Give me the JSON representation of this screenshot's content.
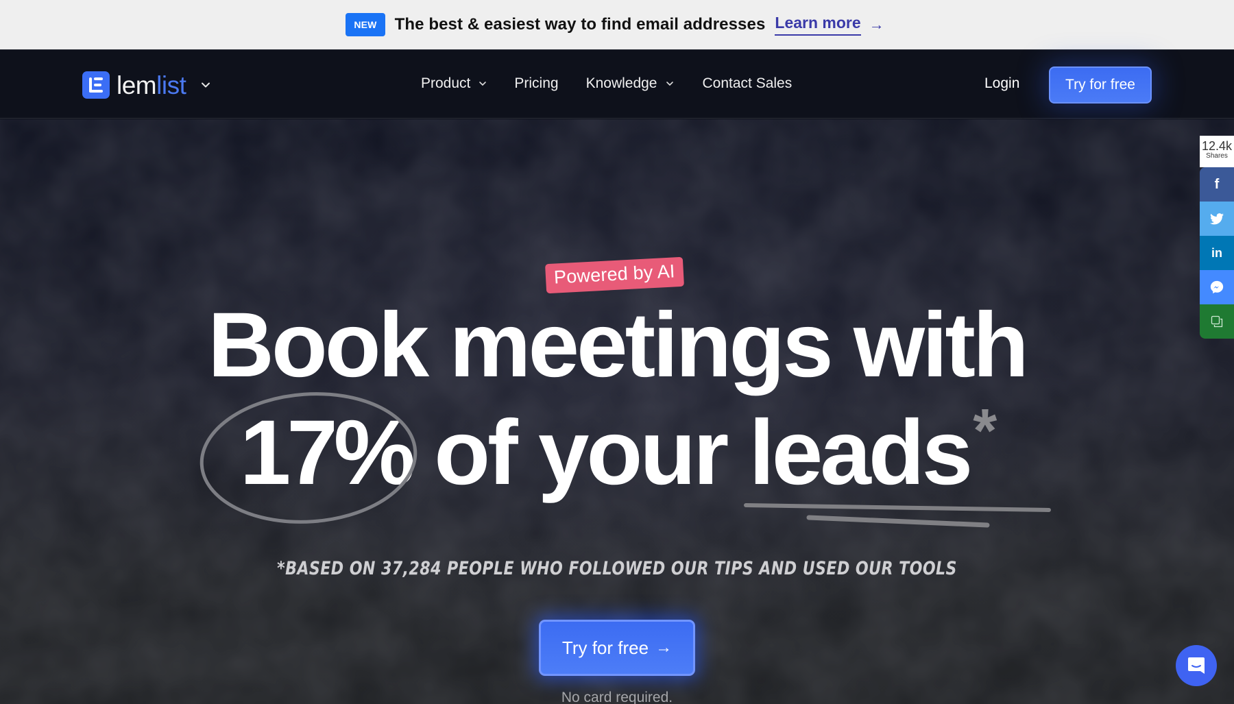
{
  "announcement": {
    "badge": "NEW",
    "text": "The best & easiest way to find email addresses",
    "link_label": "Learn more",
    "arrow": "→"
  },
  "nav": {
    "logo": {
      "part1": "lem",
      "part2": "list"
    },
    "menu": [
      {
        "label": "Product",
        "has_dropdown": true
      },
      {
        "label": "Pricing",
        "has_dropdown": false
      },
      {
        "label": "Knowledge",
        "has_dropdown": true
      },
      {
        "label": "Contact Sales",
        "has_dropdown": false
      }
    ],
    "login_label": "Login",
    "cta_label": "Try for free"
  },
  "hero": {
    "tag": "Powered by AI",
    "headline_line1": "Book meetings with",
    "headline_pct": "17%",
    "headline_rest": "of your leads",
    "headline_star": "*",
    "footnote": "*Based on  37,284  people who followed  our tips and used our tools",
    "cta_label": "Try for free",
    "cta_arrow": "→",
    "subnote": "No card required."
  },
  "share": {
    "count": "12.4k",
    "count_label": "Shares",
    "buttons": [
      {
        "icon": "facebook-icon",
        "glyph": "f"
      },
      {
        "icon": "twitter-icon",
        "glyph": ""
      },
      {
        "icon": "linkedin-icon",
        "glyph": "in"
      },
      {
        "icon": "messenger-icon",
        "glyph": ""
      },
      {
        "icon": "copy-icon",
        "glyph": ""
      }
    ]
  },
  "colors": {
    "brand_blue": "#3b6ef5",
    "tag_pink": "#e85b78",
    "link_indigo": "#3a3aa8",
    "badge_blue": "#1a73f5"
  }
}
